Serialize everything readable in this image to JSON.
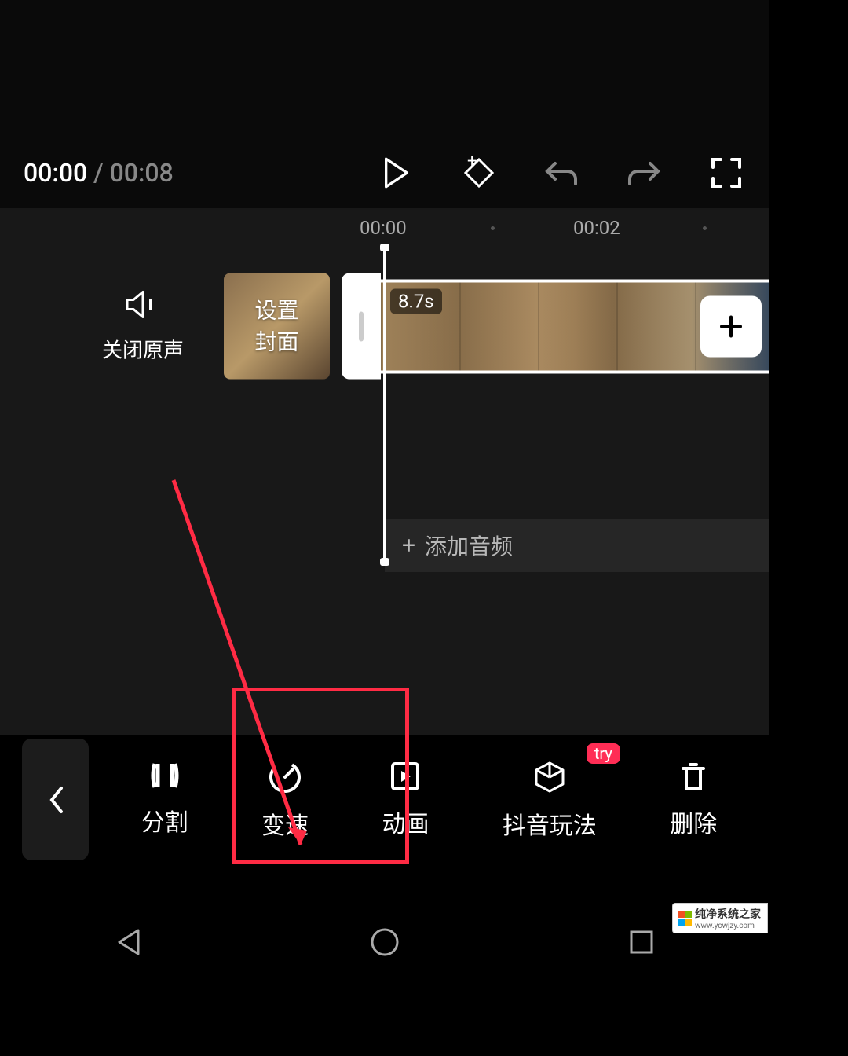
{
  "player": {
    "currentTime": "00:00",
    "separator": " / ",
    "totalTime": "00:08"
  },
  "ruler": {
    "t0": "00:00",
    "t2": "00:02"
  },
  "mute": {
    "label": "关闭原声"
  },
  "cover": {
    "label": "设置\n封面"
  },
  "clip": {
    "duration": "8.7s"
  },
  "audio": {
    "addLabel": "添加音频",
    "plus": "+"
  },
  "toolbar": {
    "split": "分割",
    "speed": "变速",
    "animation": "动画",
    "douyin": "抖音玩法",
    "delete": "删除",
    "badge": "try"
  },
  "watermark": {
    "text": "纯净系统之家",
    "url": "www.ycwjzy.com"
  },
  "addClip": {
    "plus": "+"
  }
}
